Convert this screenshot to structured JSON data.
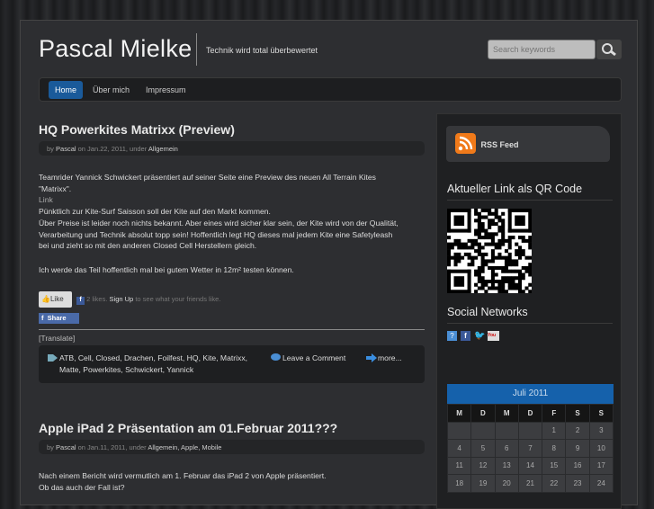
{
  "header": {
    "title": "Pascal Mielke",
    "tagline": "Technik wird total überbewertet",
    "search_placeholder": "Search keywords"
  },
  "nav": [
    "Home",
    "Über mich",
    "Impressum"
  ],
  "posts": [
    {
      "title": "HQ Powerkites Matrixx (Preview)",
      "by": "by",
      "author": "Pascal",
      "date": "on Jan.22, 2011, under",
      "category": "Allgemein",
      "lines": [
        "Teamrider Yannick Schwickert präsentiert auf seiner Seite eine Preview des neuen All Terrain Kites",
        "\"Matrixx\".",
        "Link",
        "Pünktlich zur Kite-Surf Saisson soll der Kite auf den Markt kommen.",
        "Über Preise ist leider noch nichts bekannt. Aber eines wird sicher klar sein, der Kite wird von der Qualität,",
        "Verarbeitung und Technik absolut topp sein! Hoffentlich legt HQ dieses mal jedem Kite eine Safetyleash",
        "bei und zieht so mit den anderen Closed Cell Herstellern gleich."
      ],
      "line2": "Ich werde das Teil hoffentlich mal bei gutem Wetter in 12m² testen können.",
      "like": "Like",
      "likes_count": "2 likes.",
      "signup": "Sign Up",
      "likes_rest": "to see what your friends like.",
      "share": "Share",
      "translate": "[Translate]",
      "tags": "ATB, Cell, Closed, Drachen, Foilfest, HQ, Kite, Matrixx,",
      "tags2": "Matte, Powerkites, Schwickert, Yannick",
      "comment": "Leave a Comment",
      "more": "more..."
    },
    {
      "title": "Apple iPad 2 Präsentation am 01.Februar 2011???",
      "by": "by",
      "author": "Pascal",
      "date": "on Jan.11, 2011, under",
      "category": "Allgemein, Apple, Mobile",
      "lines": [
        "Nach einem Bericht wird vermutlich am 1. Februar das iPad 2 von Apple präsentiert.",
        "Ob das auch der Fall ist?"
      ]
    }
  ],
  "sidebar": {
    "rss": "RSS Feed",
    "qr_title": "Aktueller Link als QR Code",
    "social_title": "Social Networks",
    "calendar": {
      "month": "Juli 2011",
      "days": [
        "M",
        "D",
        "M",
        "D",
        "F",
        "S",
        "S"
      ],
      "weeks": [
        [
          "",
          "",
          "",
          "",
          "1",
          "2",
          "3"
        ],
        [
          "4",
          "5",
          "6",
          "7",
          "8",
          "9",
          "10"
        ],
        [
          "11",
          "12",
          "13",
          "14",
          "15",
          "16",
          "17"
        ],
        [
          "18",
          "19",
          "20",
          "21",
          "22",
          "23",
          "24"
        ]
      ]
    }
  },
  "colors": {
    "accent": "#1a5a9a",
    "calendar_header": "#1561ab"
  }
}
